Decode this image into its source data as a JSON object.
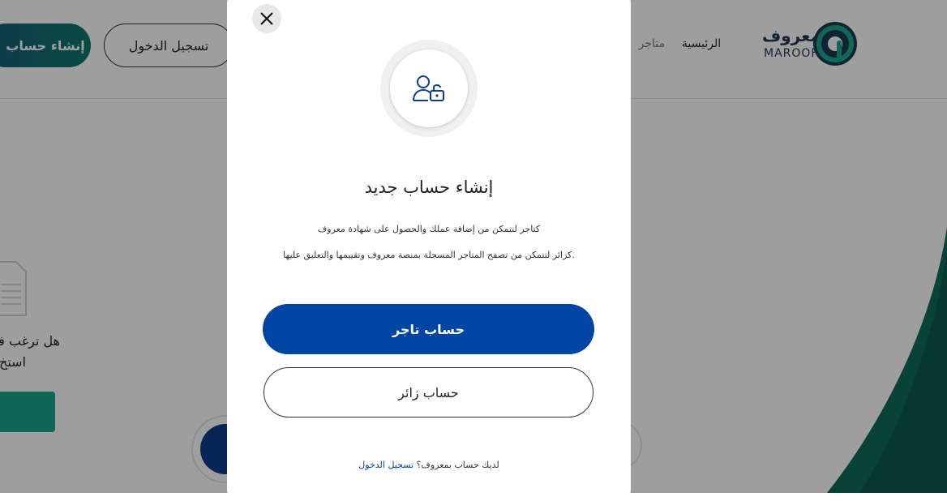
{
  "header": {
    "create_account_label": "إنشاء حساب",
    "login_label": "تسجيل الدخول",
    "nav_home": "الرئيسية",
    "nav_stores": "متاجر",
    "logo_ar": "معروف",
    "logo_en": "MAROOF"
  },
  "side_card": {
    "question_line1": "هل ترغب في",
    "question_line2": "استخ"
  },
  "modal": {
    "title": "إنشاء حساب جديد",
    "merchant_desc": "كتاجر لتتمكن من إضافة عملك والحصول على شهادة معروف",
    "visitor_desc": "كزائر لتتمكن من تصفح المتاجر المسجلة بمنصة معروف وتقييمها والتعليق عليها.",
    "merchant_button": "حساب تاجر",
    "visitor_button": "حساب زائر",
    "footer_text": "لديك حساب بمعروف؟",
    "footer_link": "تسجيل الدخول",
    "icons": {
      "close": "close-icon",
      "user_lock": "user-lock-icon"
    }
  },
  "colors": {
    "primary": "#0044a4",
    "overlay": "rgba(0,0,0,0.38)",
    "brand_green": "#1aa78f",
    "brand_dark": "#1e3a55"
  }
}
